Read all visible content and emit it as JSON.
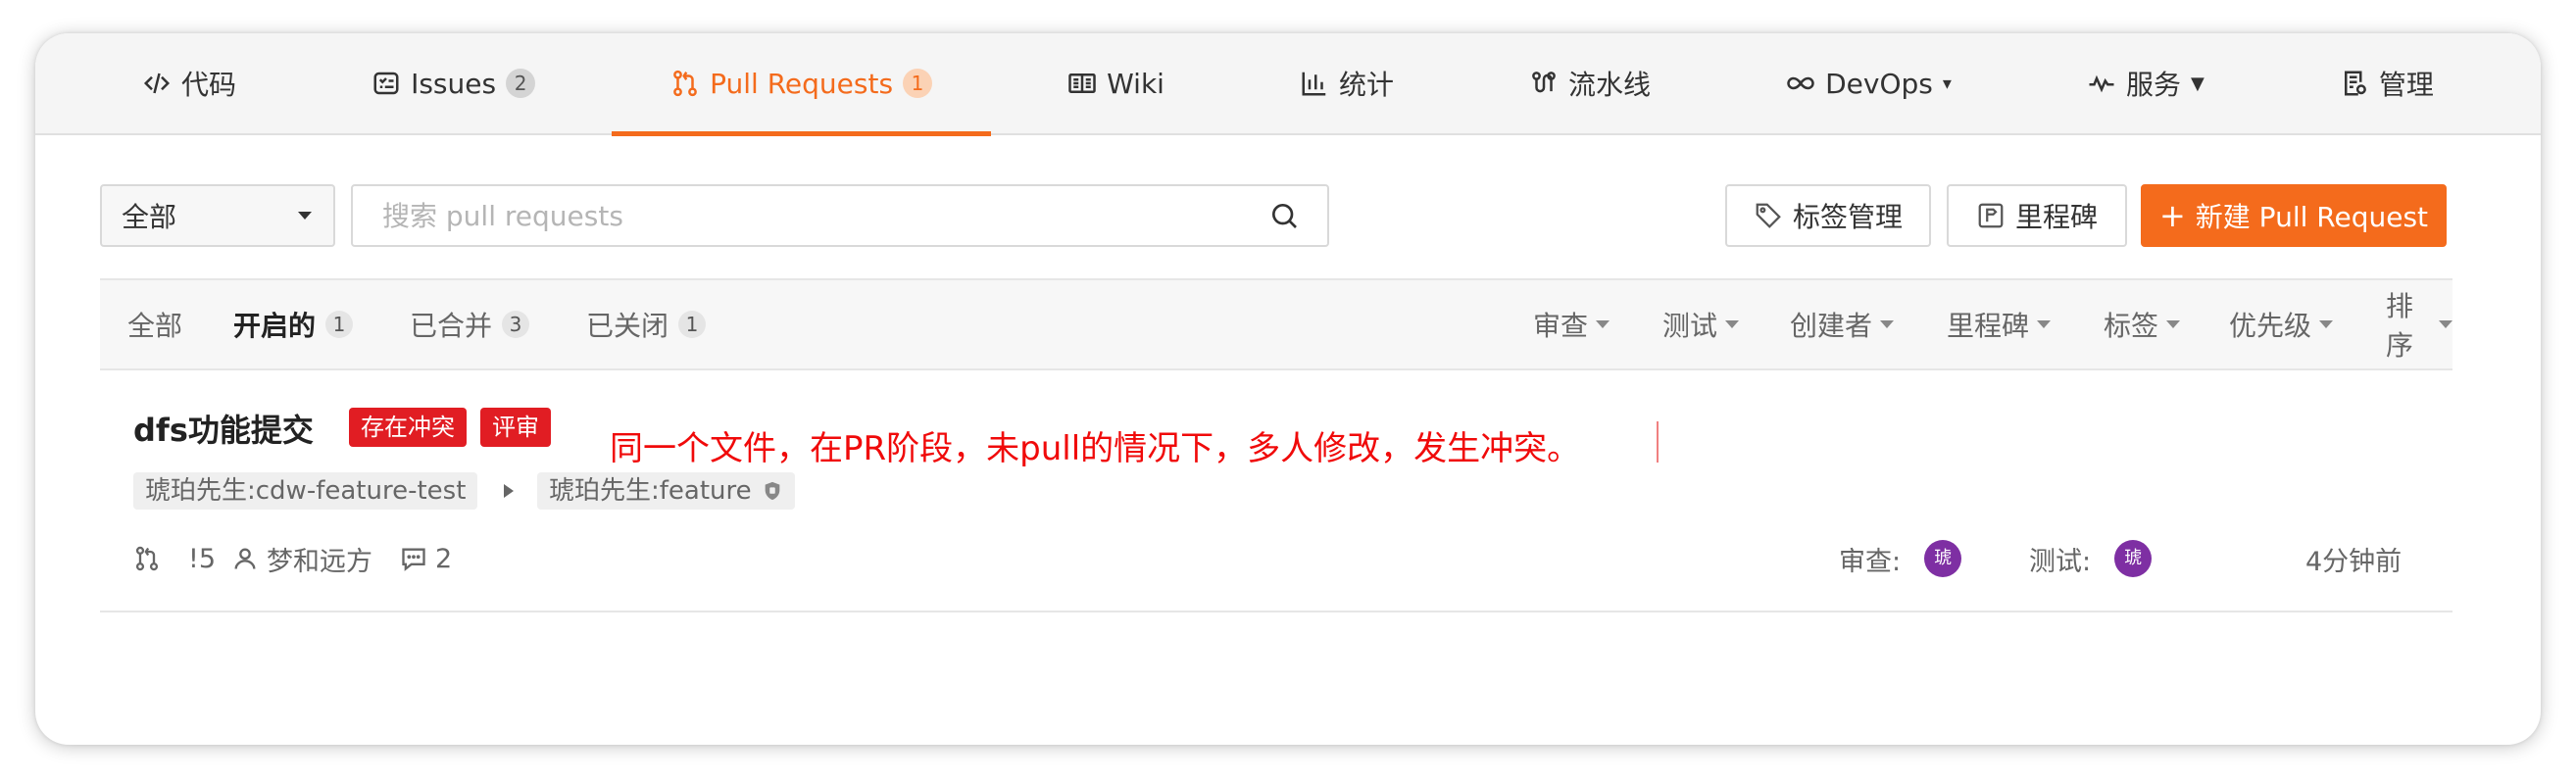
{
  "nav": {
    "tabs": [
      {
        "label": "代码",
        "icon": "code-icon"
      },
      {
        "label": "Issues",
        "count": "2",
        "icon": "issues-icon"
      },
      {
        "label": "Pull Requests",
        "count": "1",
        "icon": "pull-request-icon"
      },
      {
        "label": "Wiki",
        "icon": "wiki-icon"
      },
      {
        "label": "统计",
        "icon": "chart-icon"
      },
      {
        "label": "流水线",
        "icon": "pipeline-icon"
      },
      {
        "label": "DevOps",
        "icon": "infinity-icon"
      },
      {
        "label": "服务",
        "icon": "pulse-icon"
      },
      {
        "label": "管理",
        "icon": "manage-icon"
      }
    ]
  },
  "toolbar": {
    "select_value": "全部",
    "search_placeholder": "搜索 pull requests",
    "label_manage": "标签管理",
    "milestone": "里程碑",
    "new_pr": "新建 Pull Request"
  },
  "filter": {
    "tabs": [
      {
        "label": "全部"
      },
      {
        "label": "开启的",
        "count": "1"
      },
      {
        "label": "已合并",
        "count": "3"
      },
      {
        "label": "已关闭",
        "count": "1"
      }
    ],
    "dropdowns": [
      "审查",
      "测试",
      "创建者",
      "里程碑",
      "标签",
      "优先级",
      "排序"
    ]
  },
  "pr": {
    "title": "dfs功能提交",
    "badge_conflict": "存在冲突",
    "badge_review": "评审",
    "annotation": "同一个文件，在PR阶段，未pull的情况下，多人修改，发生冲突。",
    "source_branch": "琥珀先生:cdw-feature-test",
    "target_branch": "琥珀先生:feature",
    "number": "!5",
    "author": "梦和远方",
    "comments": "2",
    "reviewer_label": "审查:",
    "reviewer_avatar": "琥",
    "tester_label": "测试:",
    "tester_avatar": "琥",
    "time": "4分钟前"
  },
  "colors": {
    "accent": "#f46b1c",
    "danger": "#e11d23",
    "annotation": "#f00a0a",
    "avatar": "#7e2fa3"
  }
}
